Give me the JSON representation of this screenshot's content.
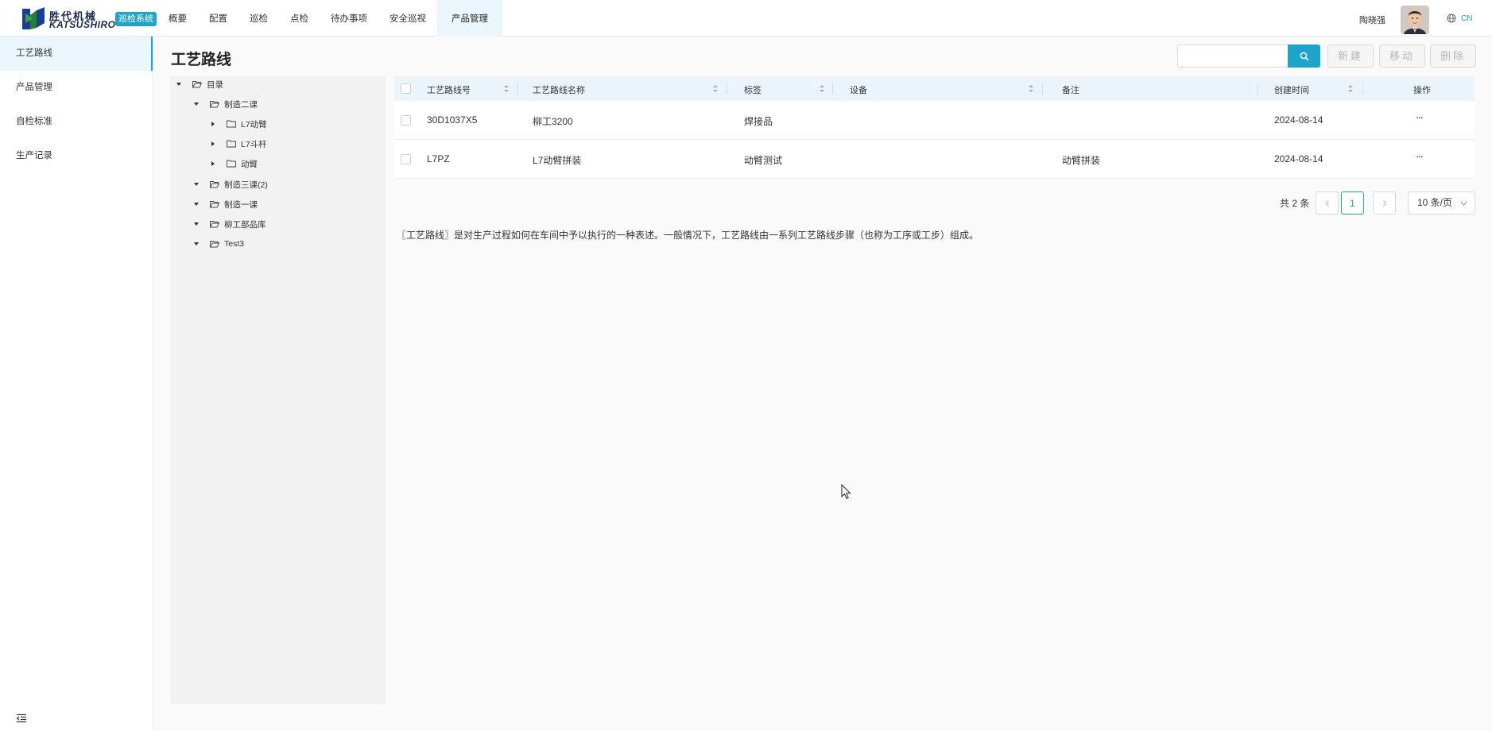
{
  "brand": {
    "logo_cn": "胜代机械",
    "logo_en": "KATSUSHIRO",
    "system_badge": "巡检系统"
  },
  "nav": {
    "items": [
      {
        "label": "概要"
      },
      {
        "label": "配置"
      },
      {
        "label": "巡检"
      },
      {
        "label": "点检"
      },
      {
        "label": "待办事项"
      },
      {
        "label": "安全巡视"
      },
      {
        "label": "产品管理",
        "active": true
      }
    ]
  },
  "user": {
    "name": "陶晓强",
    "lang": "CN"
  },
  "sidebar": {
    "items": [
      {
        "label": "工艺路线",
        "active": true
      },
      {
        "label": "产品管理"
      },
      {
        "label": "自检标准"
      },
      {
        "label": "生产记录"
      }
    ]
  },
  "page": {
    "title": "工艺路线",
    "search_placeholder": "",
    "buttons": {
      "new": "新建",
      "move": "移动",
      "delete": "删除"
    }
  },
  "tree": {
    "nodes": [
      {
        "label": "目录",
        "level": 0,
        "expanded": true
      },
      {
        "label": "制造二课",
        "level": 1,
        "expanded": true
      },
      {
        "label": "L7动臂",
        "level": 2,
        "expanded": false
      },
      {
        "label": "L7斗杆",
        "level": 2,
        "expanded": false
      },
      {
        "label": "动臂",
        "level": 2,
        "expanded": false
      },
      {
        "label": "制造三课(2)",
        "level": 1,
        "expanded": true
      },
      {
        "label": "制造一课",
        "level": 1,
        "expanded": true
      },
      {
        "label": "柳工部品库",
        "level": 1,
        "expanded": true
      },
      {
        "label": "Test3",
        "level": 1,
        "expanded": true
      }
    ]
  },
  "table": {
    "columns": {
      "code": "工艺路线号",
      "name": "工艺路线名称",
      "tag": "标签",
      "device": "设备",
      "remark": "备注",
      "created": "创建时间",
      "action": "操作"
    },
    "rows": [
      {
        "code": "30D1037X5",
        "name": "柳工3200",
        "tag": "焊接品",
        "device": "",
        "remark": "",
        "created": "2024-08-14",
        "action": "···"
      },
      {
        "code": "L7PZ",
        "name": "L7动臂拼装",
        "tag": "动臂测试",
        "device": "",
        "remark": "动臂拼装",
        "created": "2024-08-14",
        "action": "···"
      }
    ]
  },
  "pagination": {
    "total": "共 2 条",
    "current": "1",
    "page_size": "10 条/页"
  },
  "description": "〖工艺路线〗是对生产过程如何在车间中予以执行的一种表述。一般情况下，工艺路线由一系列工艺路线步骤（也称为工序或工步）组成。",
  "colors": {
    "accent": "#1fa4c9",
    "active_bg": "#eaf6fb"
  }
}
